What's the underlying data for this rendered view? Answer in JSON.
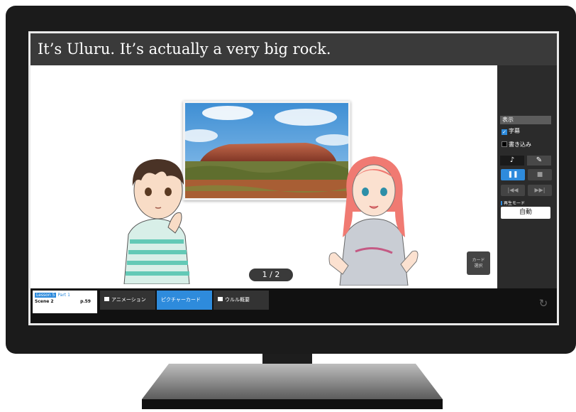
{
  "caption": "It’s Uluru. It’s actually a very big rock.",
  "pager": "1 / 2",
  "card_select": [
    "カード",
    "選択"
  ],
  "side": {
    "display_heading": "表示",
    "subtitles_label": "字幕",
    "subtitles_checked": true,
    "writing_label": "書き込み",
    "writing_checked": false,
    "tab_audio": "♪",
    "tab_pen": "✎",
    "pause_glyph": "❚❚",
    "stop_glyph": "■",
    "prev_glyph": "|◀◀",
    "next_glyph": "▶▶|",
    "playback_mode_label": "再生モード",
    "playback_mode_value": "自動"
  },
  "bottom": {
    "lesson_tag": "Lesson 5",
    "lesson_part": "Part 1",
    "scene": "Scene 2",
    "page": "p.59",
    "tabs": [
      "アニメーション",
      "ピクチャーカード",
      "ウルル概要"
    ],
    "active_tab_index": 1,
    "reset_glyph": "↻"
  },
  "colors": {
    "accent": "#2e8bdc",
    "caption_bg": "#3a3a3a",
    "panel_bg": "#2b2b2b"
  }
}
